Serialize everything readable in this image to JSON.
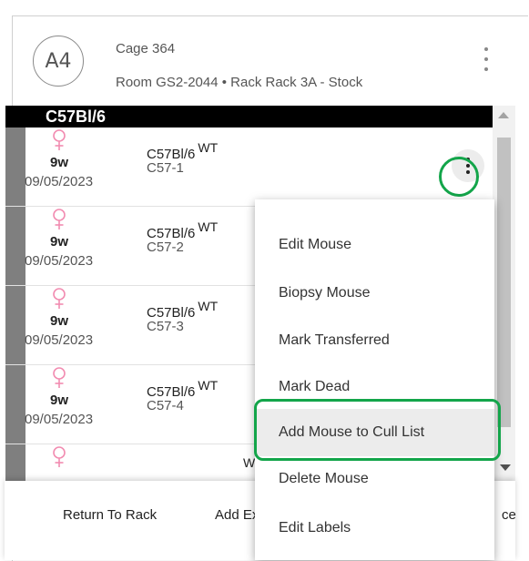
{
  "header": {
    "avatar_text": "A4",
    "cage_title": "Cage 364",
    "location": "Room GS2-2044 • Rack Rack 3A - Stock",
    "menu_icon": "kebab-vertical-icon"
  },
  "strain_group": {
    "label": "C57Bl/6"
  },
  "rows": [
    {
      "sex_icon": "female-icon",
      "age": "9w",
      "date": "09/05/2023",
      "strain": "C57Bl/6",
      "genotype": "WT",
      "mouse_id": "C57-1"
    },
    {
      "sex_icon": "female-icon",
      "age": "9w",
      "date": "09/05/2023",
      "strain": "C57Bl/6",
      "genotype": "WT",
      "mouse_id": "C57-2"
    },
    {
      "sex_icon": "female-icon",
      "age": "9w",
      "date": "09/05/2023",
      "strain": "C57Bl/6",
      "genotype": "WT",
      "mouse_id": "C57-3"
    },
    {
      "sex_icon": "female-icon",
      "age": "9w",
      "date": "09/05/2023",
      "strain": "C57Bl/6",
      "genotype": "WT",
      "mouse_id": "C57-4"
    },
    {
      "sex_icon": "female-icon",
      "age": "",
      "date": "",
      "strain": "",
      "genotype": "WT",
      "mouse_id": ""
    }
  ],
  "context_menu": {
    "items": [
      {
        "label": "Edit Mouse"
      },
      {
        "label": "Biopsy Mouse"
      },
      {
        "label": "Mark Transferred"
      },
      {
        "label": "Mark Dead"
      },
      {
        "label": "Add Mouse to Cull List"
      },
      {
        "label": "Delete Mouse"
      },
      {
        "label": "Edit Labels"
      }
    ],
    "highlighted": "Add Mouse to Cull List"
  },
  "footer": {
    "return_label": "Return To Rack",
    "add_label": "Add Ex",
    "right_label": "ce"
  },
  "colors": {
    "accent_highlight": "#13a54a",
    "female_icon": "#f28cb1",
    "strain_bar": "#000000"
  }
}
